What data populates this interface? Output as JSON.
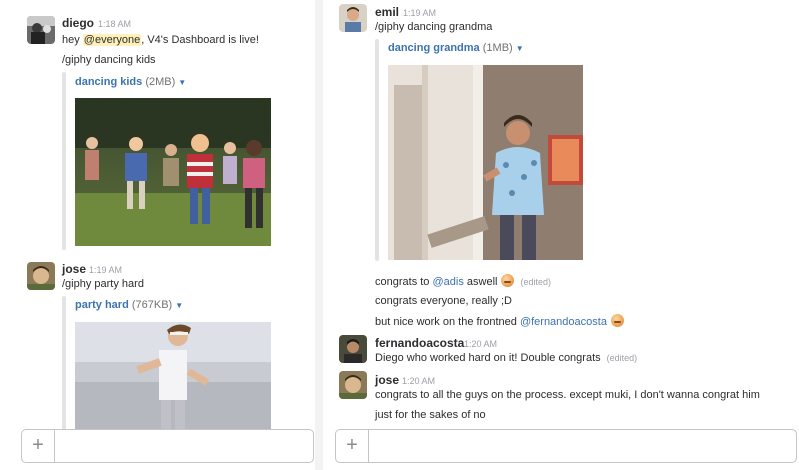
{
  "left": {
    "messages": [
      {
        "user": "diego",
        "time": "1:18 AM",
        "text_before": "hey ",
        "mention": "@everyone",
        "text_after": ", V4's Dashboard is live!",
        "command": "/giphy dancing kids",
        "file_name": "dancing kids",
        "file_size": "(2MB)"
      },
      {
        "user": "jose",
        "time": "1:19 AM",
        "command": "/giphy party hard",
        "file_name": "party hard",
        "file_size": "(767KB)"
      }
    ],
    "composer": {
      "plus": "+",
      "placeholder": ""
    }
  },
  "right": {
    "messages": [
      {
        "user": "emil",
        "time": "1:19 AM",
        "command": "/giphy dancing grandma",
        "file_name": "dancing grandma",
        "file_size": "(1MB)"
      }
    ],
    "continuation": {
      "line1_prefix": "congrats to ",
      "line1_mention": "@adis",
      "line1_suffix": " aswell",
      "line1_edited": "(edited)",
      "line2": "congrats everyone, really ;D",
      "line3_prefix": "but nice work on the frontned ",
      "line3_mention": "@fernandoacosta"
    },
    "fernando": {
      "user": "fernandoacosta",
      "time": "1:20 AM",
      "text": "Diego who worked hard on it! Double congrats",
      "edited": "(edited)"
    },
    "jose2": {
      "user": "jose",
      "time": "1:20 AM",
      "line1": "congrats to all the guys on the process. except muki, I don't wanna congrat him",
      "line2": "just for the sakes of no"
    },
    "composer": {
      "plus": "+",
      "placeholder": ""
    }
  },
  "icons": {
    "caret": "caret-down-icon",
    "plus": "plus-icon",
    "emoji": "smile-emoji-icon"
  },
  "colors": {
    "link": "#3b73af",
    "mention_highlight": "#fff1b8",
    "muted": "#9e9ea6"
  }
}
